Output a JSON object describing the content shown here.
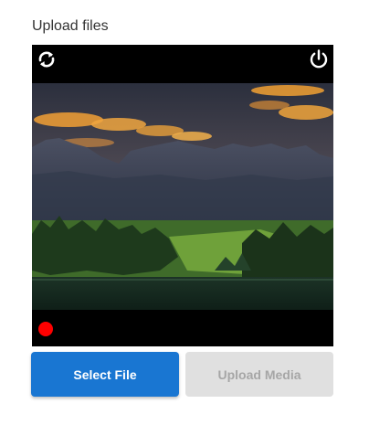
{
  "header": {
    "title": "Upload files"
  },
  "camera": {
    "switch_icon": "switch-camera-icon",
    "power_icon": "power-icon",
    "record_indicator_color": "#ff0000",
    "preview_alt": "Mountain landscape at sunset over a lake"
  },
  "actions": {
    "select_file_label": "Select File",
    "upload_media_label": "Upload Media",
    "upload_media_disabled": true
  },
  "colors": {
    "primary": "#1976d2",
    "disabled_bg": "#e0e0e0",
    "disabled_text": "#a6a6a6"
  }
}
